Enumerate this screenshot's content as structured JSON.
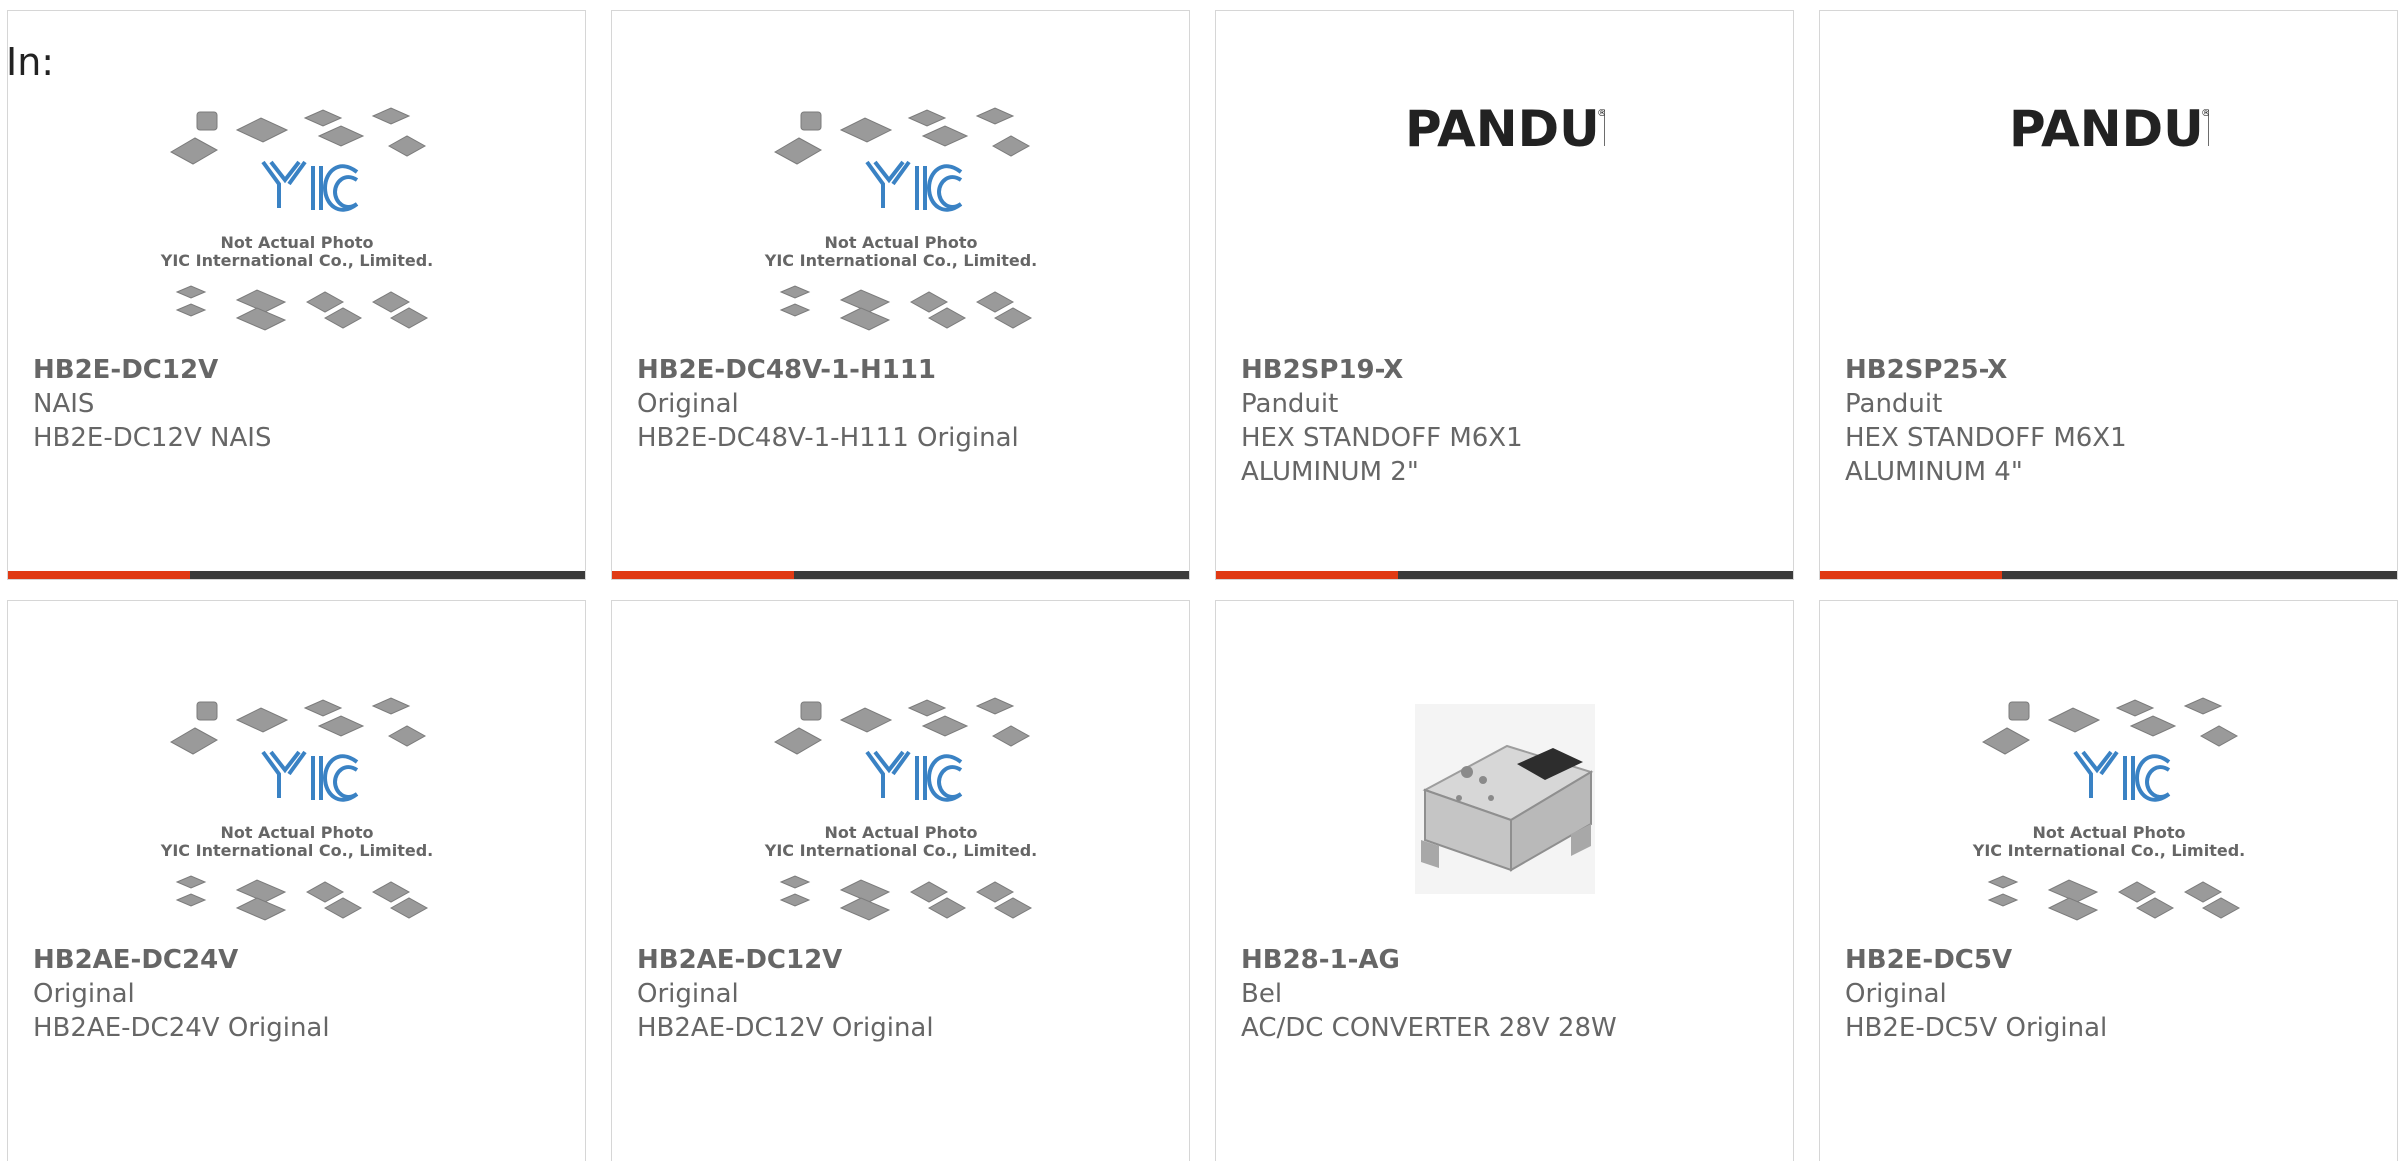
{
  "page": {
    "label": "In:"
  },
  "cards": [
    {
      "part_number": "HB2E-DC12V",
      "manufacturer": "NAIS",
      "description": "HB2E-DC12V NAIS",
      "image_type": "placeholder-yic-icon",
      "image_caption_1": "Not Actual Photo",
      "image_caption_2": "YIC International Co., Limited."
    },
    {
      "part_number": "HB2E-DC48V-1-H111",
      "manufacturer": "Original",
      "description": "HB2E-DC48V-1-H111 Original",
      "image_type": "placeholder-yic-icon",
      "image_caption_1": "Not Actual Photo",
      "image_caption_2": "YIC International Co., Limited."
    },
    {
      "part_number": "HB2SP19-X",
      "manufacturer": "Panduit",
      "description": "HEX STANDOFF M6X1 ALUMINUM 2\"",
      "image_type": "panduit-logo-icon",
      "logo_text": "PANDUIT"
    },
    {
      "part_number": "HB2SP25-X",
      "manufacturer": "Panduit",
      "description": "HEX STANDOFF M6X1 ALUMINUM 4\"",
      "image_type": "panduit-logo-icon",
      "logo_text": "PANDUIT"
    },
    {
      "part_number": "HB2AE-DC24V",
      "manufacturer": "Original",
      "description": "HB2AE-DC24V Original",
      "image_type": "placeholder-yic-icon",
      "image_caption_1": "Not Actual Photo",
      "image_caption_2": "YIC International Co., Limited."
    },
    {
      "part_number": "HB2AE-DC12V",
      "manufacturer": "Original",
      "description": "HB2AE-DC12V Original",
      "image_type": "placeholder-yic-icon",
      "image_caption_1": "Not Actual Photo",
      "image_caption_2": "YIC International Co., Limited."
    },
    {
      "part_number": "HB28-1-AG",
      "manufacturer": "Bel",
      "description": "AC/DC CONVERTER 28V 28W",
      "image_type": "power-supply-photo-icon"
    },
    {
      "part_number": "HB2E-DC5V",
      "manufacturer": "Original",
      "description": "HB2E-DC5V Original",
      "image_type": "placeholder-yic-icon",
      "image_caption_1": "Not Actual Photo",
      "image_caption_2": "YIC International Co., Limited."
    }
  ],
  "colors": {
    "accent": "#e03a14",
    "bar_dark": "#3b3b3b",
    "text_gray": "#666666",
    "border": "#d6d6d6",
    "yic_blue": "#3a82c4"
  }
}
